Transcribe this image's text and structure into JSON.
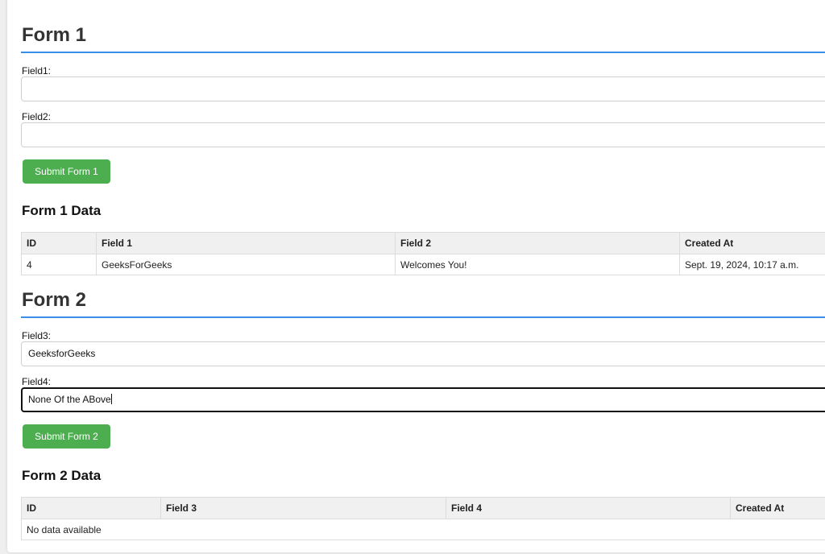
{
  "form1": {
    "title": "Form 1",
    "field1_label": "Field1:",
    "field1_value": "",
    "field2_label": "Field2:",
    "field2_value": "",
    "submit_label": "Submit Form 1"
  },
  "form1_data": {
    "title": "Form 1 Data",
    "columns": [
      "ID",
      "Field 1",
      "Field 2",
      "Created At"
    ],
    "rows": [
      [
        "4",
        "GeeksForGeeks",
        "Welcomes You!",
        "Sept. 19, 2024, 10:17 a.m."
      ]
    ]
  },
  "form2": {
    "title": "Form 2",
    "field3_label": "Field3:",
    "field3_value": "GeeksforGeeks",
    "field4_label": "Field4:",
    "field4_value": "None Of the ABove",
    "submit_label": "Submit Form 2"
  },
  "form2_data": {
    "title": "Form 2 Data",
    "columns": [
      "ID",
      "Field 3",
      "Field 4",
      "Created At"
    ],
    "empty_message": "No data available"
  },
  "colors": {
    "accent_rule": "#3b8ee6",
    "button": "#4cae4f"
  }
}
